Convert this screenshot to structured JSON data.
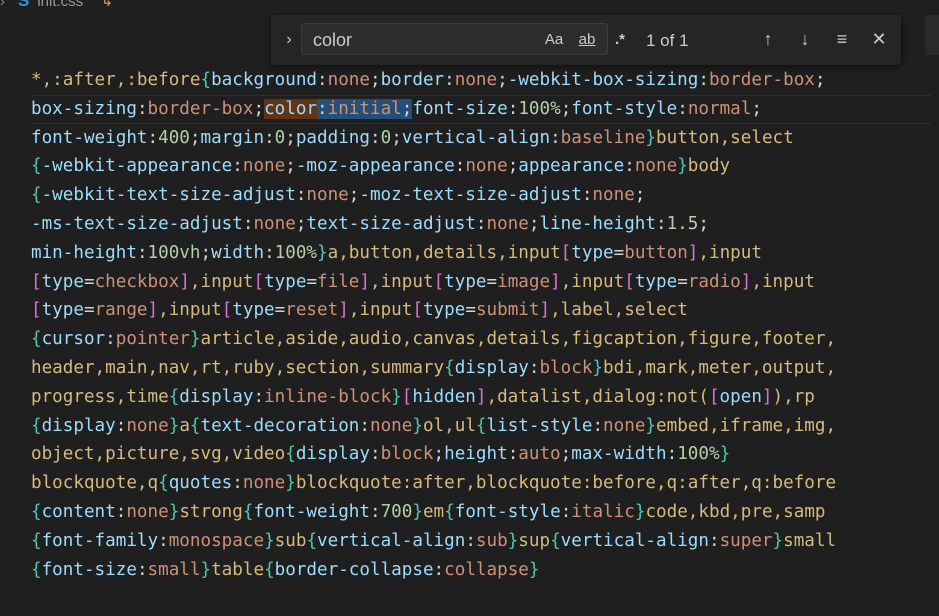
{
  "tab": {
    "filename": "init.css"
  },
  "find": {
    "query": "color",
    "match_case_label": "Aa",
    "whole_word_label": "ab",
    "regex_label": ".*",
    "count": "1 of 1"
  },
  "code_lines": [
    [
      [
        "sel",
        "*,:after,:before"
      ],
      [
        "br",
        "{"
      ],
      [
        "prop",
        "background"
      ],
      [
        "p",
        ":"
      ],
      [
        "val",
        "none"
      ],
      [
        "p",
        ";"
      ],
      [
        "prop",
        "border"
      ],
      [
        "p",
        ":"
      ],
      [
        "val",
        "none"
      ],
      [
        "p",
        ";"
      ],
      [
        "prop",
        "-webkit-box-sizing"
      ],
      [
        "p",
        ":"
      ],
      [
        "val",
        "border-box"
      ],
      [
        "p",
        ";"
      ]
    ],
    [
      [
        "prop",
        "box-sizing"
      ],
      [
        "p",
        ":"
      ],
      [
        "val",
        "border-box"
      ],
      [
        "p",
        ";"
      ],
      [
        "prop match",
        "color"
      ],
      [
        "p match-cur",
        ":"
      ],
      [
        "val match-cur",
        "initial"
      ],
      [
        "p match-cur",
        ";"
      ],
      [
        "prop",
        "font-size"
      ],
      [
        "p",
        ":"
      ],
      [
        "num",
        "100%"
      ],
      [
        "p",
        ";"
      ],
      [
        "prop",
        "font-style"
      ],
      [
        "p",
        ":"
      ],
      [
        "val",
        "normal"
      ],
      [
        "p",
        ";"
      ]
    ],
    [
      [
        "prop",
        "font-weight"
      ],
      [
        "p",
        ":"
      ],
      [
        "num",
        "400"
      ],
      [
        "p",
        ";"
      ],
      [
        "prop",
        "margin"
      ],
      [
        "p",
        ":"
      ],
      [
        "num",
        "0"
      ],
      [
        "p",
        ";"
      ],
      [
        "prop",
        "padding"
      ],
      [
        "p",
        ":"
      ],
      [
        "num",
        "0"
      ],
      [
        "p",
        ";"
      ],
      [
        "prop",
        "vertical-align"
      ],
      [
        "p",
        ":"
      ],
      [
        "val",
        "baseline"
      ],
      [
        "br",
        "}"
      ],
      [
        "sel",
        "button,select"
      ]
    ],
    [
      [
        "br",
        "{"
      ],
      [
        "prop",
        "-webkit-appearance"
      ],
      [
        "p",
        ":"
      ],
      [
        "val",
        "none"
      ],
      [
        "p",
        ";"
      ],
      [
        "prop",
        "-moz-appearance"
      ],
      [
        "p",
        ":"
      ],
      [
        "val",
        "none"
      ],
      [
        "p",
        ";"
      ],
      [
        "prop",
        "appearance"
      ],
      [
        "p",
        ":"
      ],
      [
        "val",
        "none"
      ],
      [
        "br",
        "}"
      ],
      [
        "sel",
        "body"
      ]
    ],
    [
      [
        "br",
        "{"
      ],
      [
        "prop",
        "-webkit-text-size-adjust"
      ],
      [
        "p",
        ":"
      ],
      [
        "val",
        "none"
      ],
      [
        "p",
        ";"
      ],
      [
        "prop",
        "-moz-text-size-adjust"
      ],
      [
        "p",
        ":"
      ],
      [
        "val",
        "none"
      ],
      [
        "p",
        ";"
      ]
    ],
    [
      [
        "prop",
        "-ms-text-size-adjust"
      ],
      [
        "p",
        ":"
      ],
      [
        "val",
        "none"
      ],
      [
        "p",
        ";"
      ],
      [
        "prop",
        "text-size-adjust"
      ],
      [
        "p",
        ":"
      ],
      [
        "val",
        "none"
      ],
      [
        "p",
        ";"
      ],
      [
        "prop",
        "line-height"
      ],
      [
        "p",
        ":"
      ],
      [
        "num",
        "1.5"
      ],
      [
        "p",
        ";"
      ]
    ],
    [
      [
        "prop",
        "min-height"
      ],
      [
        "p",
        ":"
      ],
      [
        "num",
        "100vh"
      ],
      [
        "p",
        ";"
      ],
      [
        "prop",
        "width"
      ],
      [
        "p",
        ":"
      ],
      [
        "num",
        "100%"
      ],
      [
        "br",
        "}"
      ],
      [
        "sel",
        "a,button,details,input"
      ],
      [
        "br2",
        "["
      ],
      [
        "prop",
        "type"
      ],
      [
        "p",
        "="
      ],
      [
        "val",
        "button"
      ],
      [
        "br2",
        "]"
      ],
      [
        "sel",
        ",input"
      ]
    ],
    [
      [
        "br2",
        "["
      ],
      [
        "prop",
        "type"
      ],
      [
        "p",
        "="
      ],
      [
        "val",
        "checkbox"
      ],
      [
        "br2",
        "]"
      ],
      [
        "sel",
        ",input"
      ],
      [
        "br2",
        "["
      ],
      [
        "prop",
        "type"
      ],
      [
        "p",
        "="
      ],
      [
        "val",
        "file"
      ],
      [
        "br2",
        "]"
      ],
      [
        "sel",
        ",input"
      ],
      [
        "br2",
        "["
      ],
      [
        "prop",
        "type"
      ],
      [
        "p",
        "="
      ],
      [
        "val",
        "image"
      ],
      [
        "br2",
        "]"
      ],
      [
        "sel",
        ",input"
      ],
      [
        "br2",
        "["
      ],
      [
        "prop",
        "type"
      ],
      [
        "p",
        "="
      ],
      [
        "val",
        "radio"
      ],
      [
        "br2",
        "]"
      ],
      [
        "sel",
        ",input"
      ]
    ],
    [
      [
        "br2",
        "["
      ],
      [
        "prop",
        "type"
      ],
      [
        "p",
        "="
      ],
      [
        "val",
        "range"
      ],
      [
        "br2",
        "]"
      ],
      [
        "sel",
        ",input"
      ],
      [
        "br2",
        "["
      ],
      [
        "prop",
        "type"
      ],
      [
        "p",
        "="
      ],
      [
        "val",
        "reset"
      ],
      [
        "br2",
        "]"
      ],
      [
        "sel",
        ",input"
      ],
      [
        "br2",
        "["
      ],
      [
        "prop",
        "type"
      ],
      [
        "p",
        "="
      ],
      [
        "val",
        "submit"
      ],
      [
        "br2",
        "]"
      ],
      [
        "sel",
        ",label,select"
      ]
    ],
    [
      [
        "br",
        "{"
      ],
      [
        "prop",
        "cursor"
      ],
      [
        "p",
        ":"
      ],
      [
        "val",
        "pointer"
      ],
      [
        "br",
        "}"
      ],
      [
        "sel",
        "article,aside,audio,canvas,details,figcaption,figure,footer,"
      ]
    ],
    [
      [
        "sel",
        "header,main,nav,rt,ruby,section,summary"
      ],
      [
        "br",
        "{"
      ],
      [
        "prop",
        "display"
      ],
      [
        "p",
        ":"
      ],
      [
        "val",
        "block"
      ],
      [
        "br",
        "}"
      ],
      [
        "sel",
        "bdi,mark,meter,output,"
      ]
    ],
    [
      [
        "sel",
        "progress,time"
      ],
      [
        "br",
        "{"
      ],
      [
        "prop",
        "display"
      ],
      [
        "p",
        ":"
      ],
      [
        "val",
        "inline-block"
      ],
      [
        "br",
        "}"
      ],
      [
        "br2",
        "["
      ],
      [
        "prop",
        "hidden"
      ],
      [
        "br2",
        "]"
      ],
      [
        "sel",
        ",datalist,dialog:not("
      ],
      [
        "br2",
        "["
      ],
      [
        "prop",
        "open"
      ],
      [
        "br2",
        "]"
      ],
      [
        "sel",
        "),rp"
      ]
    ],
    [
      [
        "br",
        "{"
      ],
      [
        "prop",
        "display"
      ],
      [
        "p",
        ":"
      ],
      [
        "val",
        "none"
      ],
      [
        "br",
        "}"
      ],
      [
        "sel",
        "a"
      ],
      [
        "br",
        "{"
      ],
      [
        "prop",
        "text-decoration"
      ],
      [
        "p",
        ":"
      ],
      [
        "val",
        "none"
      ],
      [
        "br",
        "}"
      ],
      [
        "sel",
        "ol,ul"
      ],
      [
        "br",
        "{"
      ],
      [
        "prop",
        "list-style"
      ],
      [
        "p",
        ":"
      ],
      [
        "val",
        "none"
      ],
      [
        "br",
        "}"
      ],
      [
        "sel",
        "embed,iframe,img,"
      ]
    ],
    [
      [
        "sel",
        "object,picture,svg,video"
      ],
      [
        "br",
        "{"
      ],
      [
        "prop",
        "display"
      ],
      [
        "p",
        ":"
      ],
      [
        "val",
        "block"
      ],
      [
        "p",
        ";"
      ],
      [
        "prop",
        "height"
      ],
      [
        "p",
        ":"
      ],
      [
        "val",
        "auto"
      ],
      [
        "p",
        ";"
      ],
      [
        "prop",
        "max-width"
      ],
      [
        "p",
        ":"
      ],
      [
        "num",
        "100%"
      ],
      [
        "br",
        "}"
      ]
    ],
    [
      [
        "sel",
        "blockquote,q"
      ],
      [
        "br",
        "{"
      ],
      [
        "prop",
        "quotes"
      ],
      [
        "p",
        ":"
      ],
      [
        "val",
        "none"
      ],
      [
        "br",
        "}"
      ],
      [
        "sel",
        "blockquote:after,blockquote:before,q:after,q:before"
      ]
    ],
    [
      [
        "br",
        "{"
      ],
      [
        "prop",
        "content"
      ],
      [
        "p",
        ":"
      ],
      [
        "val",
        "none"
      ],
      [
        "br",
        "}"
      ],
      [
        "sel",
        "strong"
      ],
      [
        "br",
        "{"
      ],
      [
        "prop",
        "font-weight"
      ],
      [
        "p",
        ":"
      ],
      [
        "num",
        "700"
      ],
      [
        "br",
        "}"
      ],
      [
        "sel",
        "em"
      ],
      [
        "br",
        "{"
      ],
      [
        "prop",
        "font-style"
      ],
      [
        "p",
        ":"
      ],
      [
        "val",
        "italic"
      ],
      [
        "br",
        "}"
      ],
      [
        "sel",
        "code,kbd,pre,samp"
      ]
    ],
    [
      [
        "br",
        "{"
      ],
      [
        "prop",
        "font-family"
      ],
      [
        "p",
        ":"
      ],
      [
        "val",
        "monospace"
      ],
      [
        "br",
        "}"
      ],
      [
        "sel",
        "sub"
      ],
      [
        "br",
        "{"
      ],
      [
        "prop",
        "vertical-align"
      ],
      [
        "p",
        ":"
      ],
      [
        "val",
        "sub"
      ],
      [
        "br",
        "}"
      ],
      [
        "sel",
        "sup"
      ],
      [
        "br",
        "{"
      ],
      [
        "prop",
        "vertical-align"
      ],
      [
        "p",
        ":"
      ],
      [
        "val",
        "super"
      ],
      [
        "br",
        "}"
      ],
      [
        "sel",
        "small"
      ]
    ],
    [
      [
        "br",
        "{"
      ],
      [
        "prop",
        "font-size"
      ],
      [
        "p",
        ":"
      ],
      [
        "val",
        "small"
      ],
      [
        "br",
        "}"
      ],
      [
        "sel",
        "table"
      ],
      [
        "br",
        "{"
      ],
      [
        "prop",
        "border-collapse"
      ],
      [
        "p",
        ":"
      ],
      [
        "val",
        "collapse"
      ],
      [
        "br",
        "}"
      ]
    ]
  ]
}
